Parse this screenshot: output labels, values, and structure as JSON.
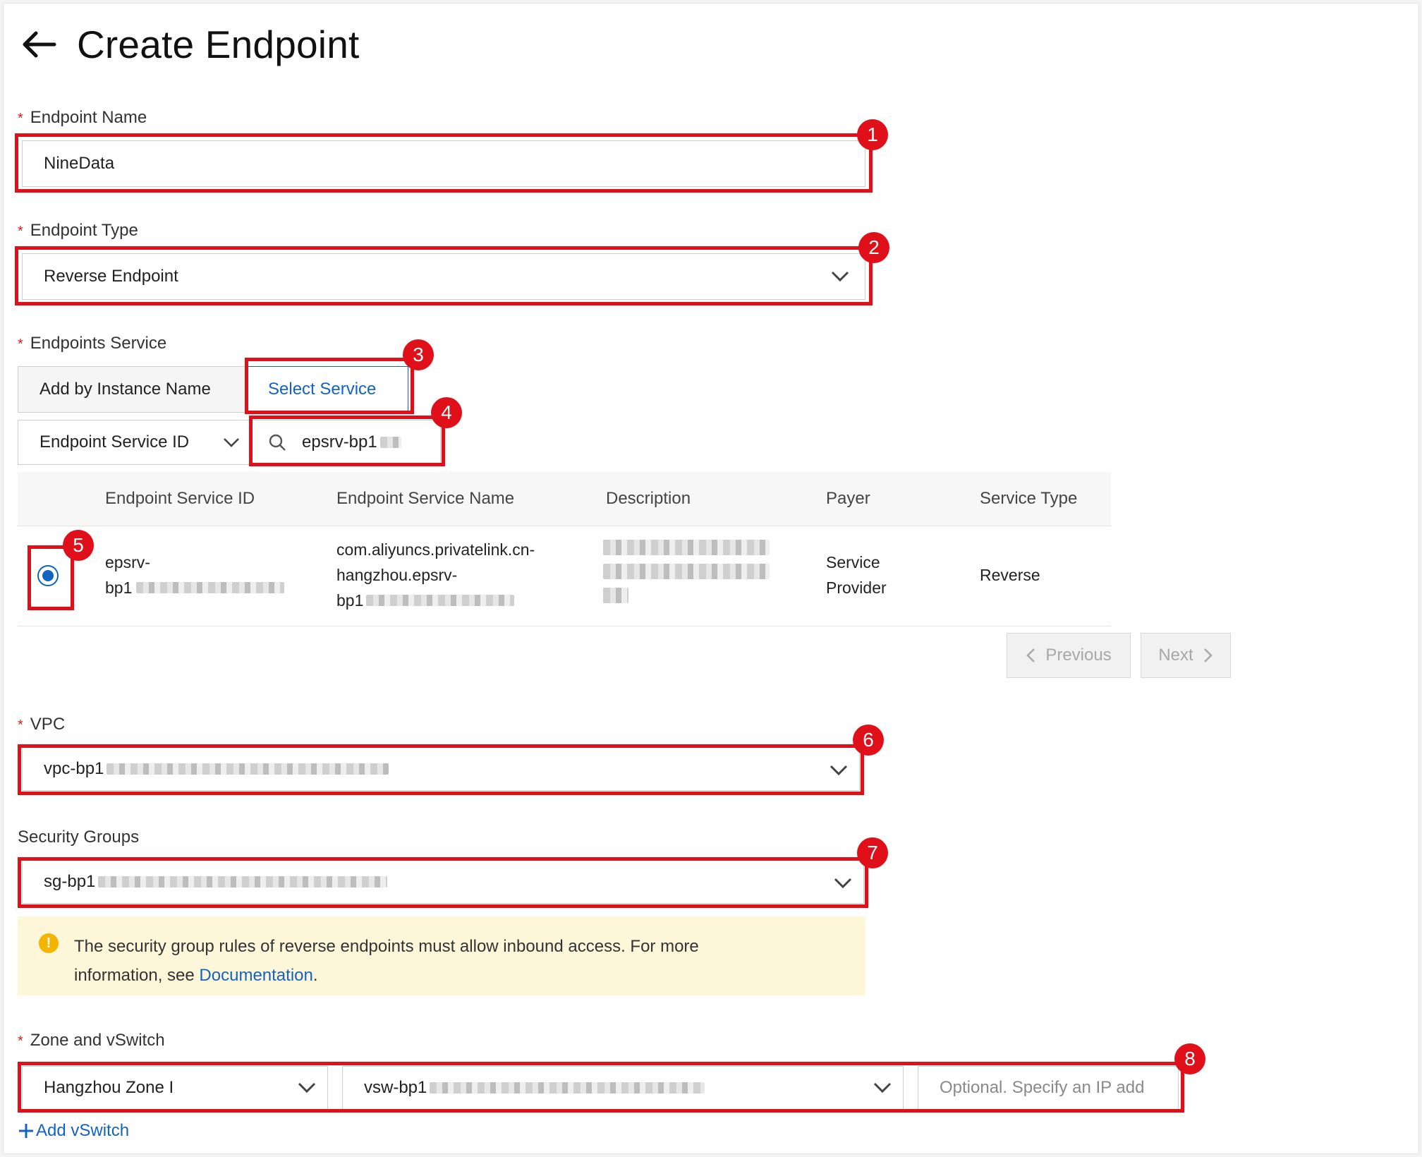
{
  "page": {
    "title": "Create Endpoint"
  },
  "endpoint_name": {
    "label": "Endpoint Name",
    "value": "NineData"
  },
  "endpoint_type": {
    "label": "Endpoint Type",
    "value": "Reverse Endpoint"
  },
  "endpoints_service": {
    "label": "Endpoints Service",
    "tabs": [
      "Add by Instance Name",
      "Select Service"
    ],
    "filter_field": "Endpoint Service ID",
    "search_value": "epsrv-bp1",
    "columns": [
      "Endpoint Service ID",
      "Endpoint Service Name",
      "Description",
      "Payer",
      "Service Type"
    ],
    "row": {
      "id_line1": "epsrv-",
      "id_line2": "bp1",
      "name_line1": "com.aliyuncs.privatelink.cn-",
      "name_line2": "hangzhou.epsrv-",
      "name_line3": "bp1",
      "payer_line1": "Service",
      "payer_line2": "Provider",
      "service_type": "Reverse"
    },
    "pagination": {
      "previous": "Previous",
      "next": "Next"
    }
  },
  "vpc": {
    "label": "VPC",
    "value": "vpc-bp1"
  },
  "security_groups": {
    "label": "Security Groups",
    "value": "sg-bp1",
    "note_text": "The security group rules of reverse endpoints must allow inbound access. For more",
    "note_text2": "information, see ",
    "note_link": "Documentation",
    "note_end": "."
  },
  "zone_vswitch": {
    "label": "Zone and vSwitch",
    "zone": "Hangzhou Zone I",
    "vswitch": "vsw-bp1",
    "ip_placeholder": "Optional. Specify an IP add",
    "add_vswitch": "Add vSwitch"
  },
  "annotations": [
    "1",
    "2",
    "3",
    "4",
    "5",
    "6",
    "7",
    "8"
  ],
  "colors": {
    "highlight": "#e0101a",
    "link": "#1463c3",
    "note_bg": "#fdf6d9",
    "warning": "#f5b400"
  }
}
